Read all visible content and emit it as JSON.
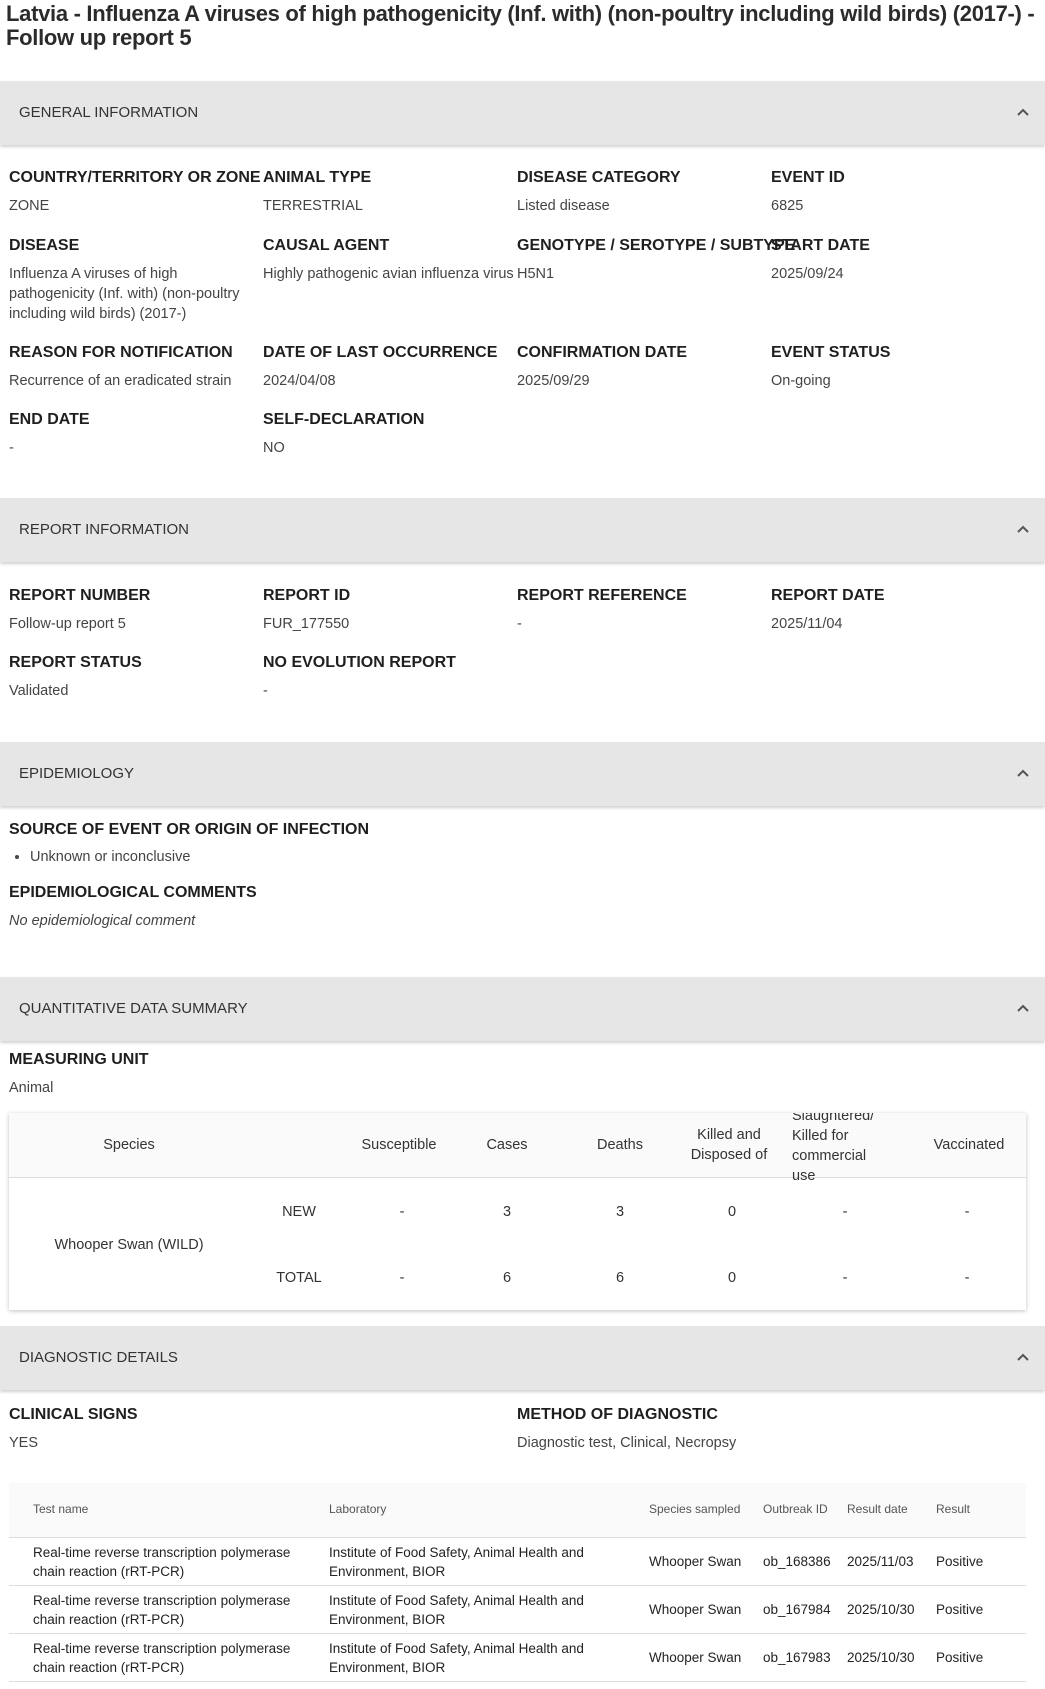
{
  "title": "Latvia - Influenza A viruses of high pathogenicity (Inf. with) (non-poultry including wild birds) (2017-) - Follow up report 5",
  "general": {
    "header": "GENERAL INFORMATION",
    "country_label": "COUNTRY/TERRITORY OR ZONE",
    "country_value": "ZONE",
    "animal_type_label": "ANIMAL TYPE",
    "animal_type_value": "TERRESTRIAL",
    "disease_category_label": "DISEASE CATEGORY",
    "disease_category_value": "Listed disease",
    "event_id_label": "EVENT ID",
    "event_id_value": "6825",
    "disease_label": "DISEASE",
    "disease_value": "Influenza A viruses of high pathogenicity (Inf. with) (non-poultry including wild birds) (2017-)",
    "causal_agent_label": "CAUSAL AGENT",
    "causal_agent_value": "Highly pathogenic avian influenza virus",
    "genotype_label": "GENOTYPE / SEROTYPE / SUBTYPE",
    "genotype_value": "H5N1",
    "start_date_label": "START DATE",
    "start_date_value": "2025/09/24",
    "reason_label": "REASON FOR NOTIFICATION",
    "reason_value": "Recurrence of an eradicated strain",
    "last_occurrence_label": "DATE OF LAST OCCURRENCE",
    "last_occurrence_value": "2024/04/08",
    "confirmation_label": "CONFIRMATION DATE",
    "confirmation_value": "2025/09/29",
    "event_status_label": "EVENT STATUS",
    "event_status_value": "On-going",
    "end_date_label": "END DATE",
    "end_date_value": "-",
    "self_declaration_label": "SELF-DECLARATION",
    "self_declaration_value": "NO"
  },
  "report": {
    "header": "REPORT INFORMATION",
    "number_label": "REPORT NUMBER",
    "number_value": "Follow-up report 5",
    "id_label": "REPORT ID",
    "id_value": "FUR_177550",
    "reference_label": "REPORT REFERENCE",
    "reference_value": "-",
    "date_label": "REPORT DATE",
    "date_value": "2025/11/04",
    "status_label": "REPORT STATUS",
    "status_value": "Validated",
    "no_evolution_label": "NO EVOLUTION REPORT",
    "no_evolution_value": "-"
  },
  "epidemiology": {
    "header": "EPIDEMIOLOGY",
    "source_label": "SOURCE OF EVENT OR ORIGIN OF INFECTION",
    "sources": [
      "Unknown or inconclusive"
    ],
    "comments_label": "EPIDEMIOLOGICAL COMMENTS",
    "comments_value": "No epidemiological comment"
  },
  "quantitative": {
    "header": "QUANTITATIVE DATA SUMMARY",
    "unit_label": "MEASURING UNIT",
    "unit_value": "Animal",
    "columns": [
      "Species",
      "Susceptible",
      "Cases",
      "Deaths",
      "Killed and Disposed of",
      "Slaughtered/ Killed for commercial use",
      "Vaccinated"
    ],
    "species": "Whooper Swan (WILD)",
    "rows": [
      {
        "label": "NEW",
        "values": [
          "-",
          "3",
          "3",
          "0",
          "-",
          "-"
        ]
      },
      {
        "label": "TOTAL",
        "values": [
          "-",
          "6",
          "6",
          "0",
          "-",
          "-"
        ]
      }
    ]
  },
  "diagnostic": {
    "header": "DIAGNOSTIC DETAILS",
    "clinical_label": "CLINICAL SIGNS",
    "clinical_value": "YES",
    "method_label": "METHOD OF DIAGNOSTIC",
    "method_value": "Diagnostic test, Clinical, Necropsy",
    "columns": [
      "Test name",
      "Laboratory",
      "Species sampled",
      "Outbreak ID",
      "Result date",
      "Result"
    ],
    "rows": [
      [
        "Real-time reverse transcription polymerase chain reaction (rRT-PCR)",
        "Institute of Food Safety, Animal Health and Environment, BIOR",
        "Whooper Swan",
        "ob_168386",
        "2025/11/03",
        "Positive"
      ],
      [
        "Real-time reverse transcription polymerase chain reaction (rRT-PCR)",
        "Institute of Food Safety, Animal Health and Environment, BIOR",
        "Whooper Swan",
        "ob_167984",
        "2025/10/30",
        "Positive"
      ],
      [
        "Real-time reverse transcription polymerase chain reaction (rRT-PCR)",
        "Institute of Food Safety, Animal Health and Environment, BIOR",
        "Whooper Swan",
        "ob_167983",
        "2025/10/30",
        "Positive"
      ]
    ]
  },
  "icons": {
    "collapse": "chevron-up-icon"
  }
}
